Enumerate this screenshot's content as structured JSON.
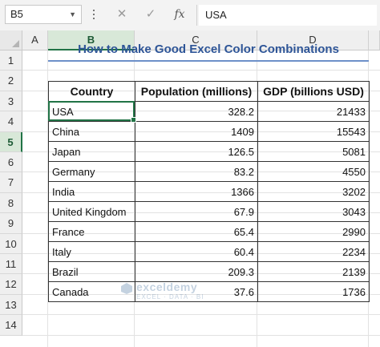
{
  "formula_bar": {
    "name_box": "B5",
    "cancel_icon": "✕",
    "enter_icon": "✓",
    "fx_label": "fx",
    "value": "USA"
  },
  "columns": [
    "A",
    "B",
    "C",
    "D"
  ],
  "rows": [
    "1",
    "2",
    "3",
    "4",
    "5",
    "6",
    "7",
    "8",
    "9",
    "10",
    "11",
    "12",
    "13",
    "14"
  ],
  "title": "How to Make Good Excel Color Combinations",
  "table": {
    "headers": [
      "Country",
      "Population (millions)",
      "GDP (billions USD)"
    ],
    "rows": [
      {
        "country": "USA",
        "population": "328.2",
        "gdp": "21433"
      },
      {
        "country": "China",
        "population": "1409",
        "gdp": "15543"
      },
      {
        "country": "Japan",
        "population": "126.5",
        "gdp": "5081"
      },
      {
        "country": "Germany",
        "population": "83.2",
        "gdp": "4550"
      },
      {
        "country": "India",
        "population": "1366",
        "gdp": "3202"
      },
      {
        "country": "United Kingdom",
        "population": "67.9",
        "gdp": "3043"
      },
      {
        "country": "France",
        "population": "65.4",
        "gdp": "2990"
      },
      {
        "country": "Italy",
        "population": "60.4",
        "gdp": "2234"
      },
      {
        "country": "Brazil",
        "population": "209.3",
        "gdp": "2139"
      },
      {
        "country": "Canada",
        "population": "37.6",
        "gdp": "1736"
      }
    ]
  },
  "selected_cell": "B5",
  "watermark": {
    "name": "exceldemy",
    "tagline": "EXCEL · DATA · BI"
  },
  "colors": {
    "accent": "#217346",
    "title": "#2e5597"
  }
}
